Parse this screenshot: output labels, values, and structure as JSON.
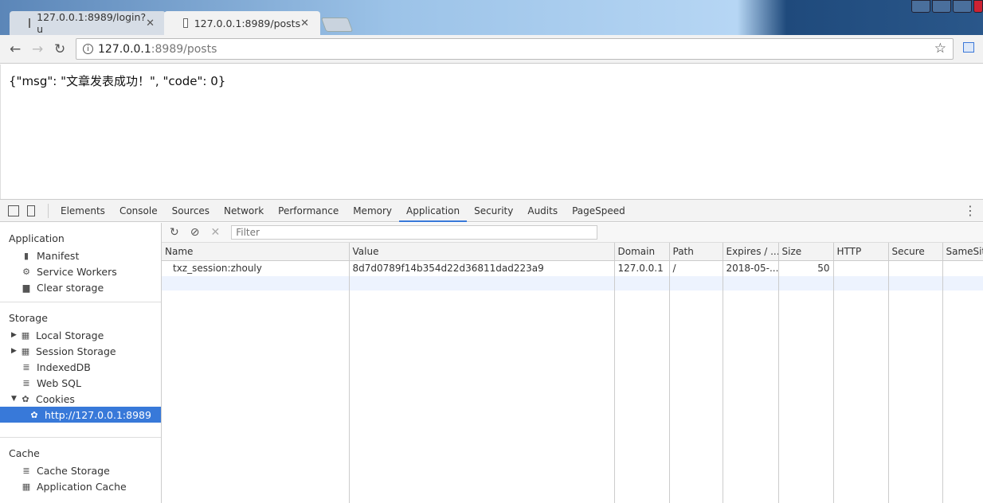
{
  "browser": {
    "tabs": [
      {
        "title": "127.0.0.1:8989/login?u",
        "active": false
      },
      {
        "title": "127.0.0.1:8989/posts",
        "active": true
      }
    ],
    "url_host": "127.0.0.1",
    "url_rest": ":8989/posts"
  },
  "page": {
    "body": "{\"msg\": \"文章发表成功！\", \"code\": 0}"
  },
  "devtools": {
    "tabs": [
      "Elements",
      "Console",
      "Sources",
      "Network",
      "Performance",
      "Memory",
      "Application",
      "Security",
      "Audits",
      "PageSpeed"
    ],
    "active_tab": "Application",
    "sidebar": {
      "application_header": "Application",
      "application_items": [
        "Manifest",
        "Service Workers",
        "Clear storage"
      ],
      "storage_header": "Storage",
      "storage_items": [
        "Local Storage",
        "Session Storage",
        "IndexedDB",
        "Web SQL",
        "Cookies"
      ],
      "cookie_origin": "http://127.0.0.1:8989",
      "cache_header": "Cache",
      "cache_items": [
        "Cache Storage",
        "Application Cache"
      ]
    },
    "filter_placeholder": "Filter",
    "columns": [
      "Name",
      "Value",
      "Domain",
      "Path",
      "Expires / ...",
      "Size",
      "HTTP",
      "Secure",
      "SameSite"
    ],
    "rows": [
      {
        "name": "txz_session:zhouly",
        "value": "8d7d0789f14b354d22d36811dad223a9",
        "domain": "127.0.0.1",
        "path": "/",
        "expires": "2018-05-...",
        "size": "50",
        "http": "",
        "secure": "",
        "samesite": ""
      }
    ]
  },
  "colors": {
    "accent": "#3879d9"
  }
}
